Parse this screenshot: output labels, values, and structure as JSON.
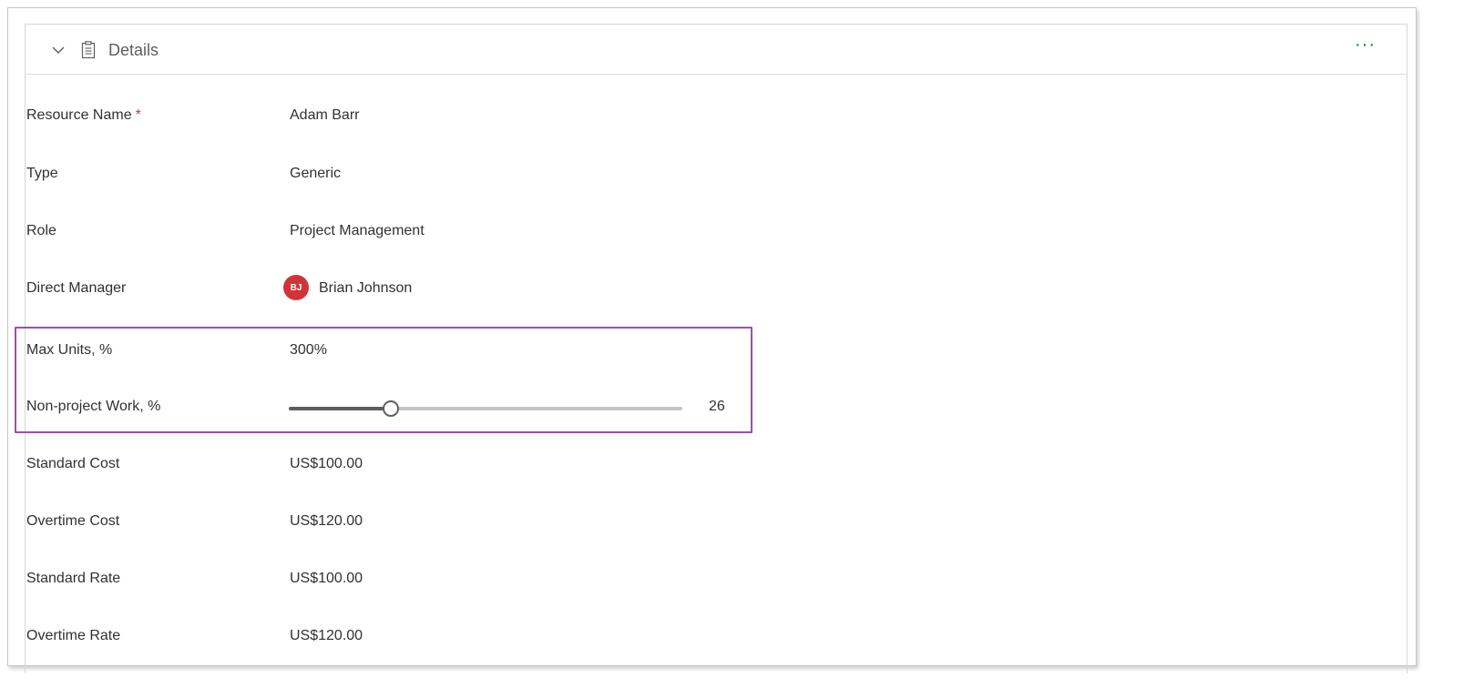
{
  "section": {
    "title": "Details",
    "more_label": "···"
  },
  "fields": {
    "resource_name": {
      "label": "Resource Name",
      "required_mark": "*",
      "value": "Adam Barr"
    },
    "type": {
      "label": "Type",
      "value": "Generic"
    },
    "role": {
      "label": "Role",
      "value": "Project Management"
    },
    "direct_manager": {
      "label": "Direct Manager",
      "initials": "BJ",
      "value": "Brian Johnson",
      "avatar_color": "#d13438"
    },
    "max_units": {
      "label": "Max Units, %",
      "value": "300%"
    },
    "non_project_work": {
      "label": "Non-project Work, %",
      "value": "26",
      "slider_percent": 26,
      "slider_max": 100
    },
    "standard_cost": {
      "label": "Standard Cost",
      "value": "US$100.00"
    },
    "overtime_cost": {
      "label": "Overtime Cost",
      "value": "US$120.00"
    },
    "standard_rate": {
      "label": "Standard Rate",
      "value": "US$100.00"
    },
    "overtime_rate": {
      "label": "Overtime Rate",
      "value": "US$120.00"
    }
  },
  "colors": {
    "highlight_border": "#9b4fb0",
    "more_icon": "#107c10",
    "required": "#d13438"
  },
  "icons": {
    "collapse": "chevron-down-icon",
    "section": "document-icon",
    "more": "more-options-icon"
  }
}
